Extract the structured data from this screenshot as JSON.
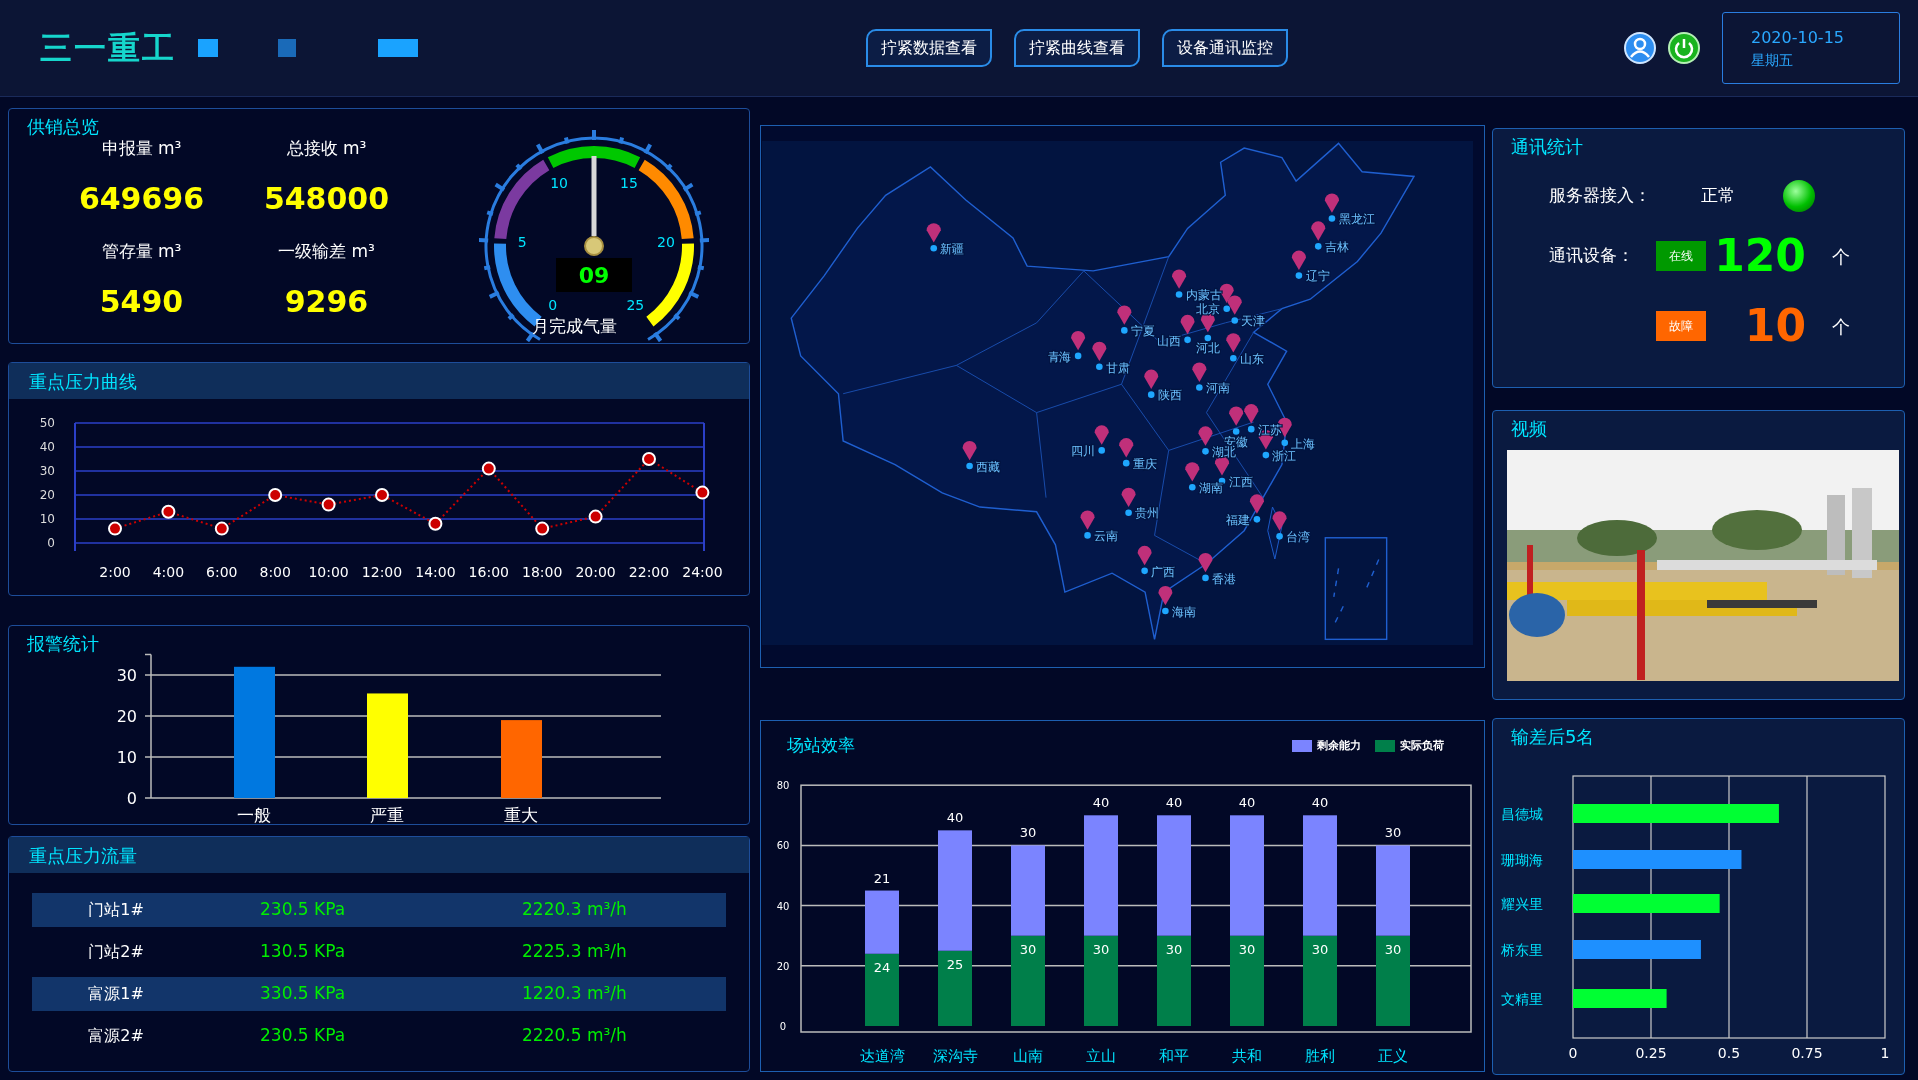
{
  "header": {
    "logo": "三一重工",
    "nav_buttons": [
      "拧紧数据查看",
      "拧紧曲线查看",
      "设备通讯监控"
    ],
    "date": "2020-10-15",
    "weekday": "星期五"
  },
  "supply_overview": {
    "title": "供销总览",
    "stats": [
      {
        "label": "申报量 m³",
        "value": "649696"
      },
      {
        "label": "总接收 m³",
        "value": "548000"
      },
      {
        "label": "管存量 m³",
        "value": "5490"
      },
      {
        "label": "一级输差 m³",
        "value": "9296"
      }
    ],
    "gauge": {
      "ticks": [
        "0",
        "5",
        "10",
        "15",
        "20",
        "25"
      ],
      "reading": "09",
      "label": "月完成气量"
    }
  },
  "pressure_curve": {
    "title": "重点压力曲线",
    "chart_data": {
      "type": "line",
      "categories": [
        "2:00",
        "4:00",
        "6:00",
        "8:00",
        "10:00",
        "12:00",
        "14:00",
        "16:00",
        "18:00",
        "20:00",
        "22:00",
        "24:00"
      ],
      "series": [
        {
          "color": "#cc0000",
          "line_style": "dotted",
          "marker": "circle",
          "values": [
            6,
            13,
            6,
            20,
            16,
            20,
            8,
            31,
            6,
            11,
            35,
            21
          ]
        }
      ],
      "ylim": [
        0,
        50
      ],
      "yticks": [
        0,
        10,
        20,
        30,
        40,
        50
      ],
      "grid": true
    }
  },
  "alarm_stats": {
    "title": "报警统计",
    "chart_data": {
      "type": "bar",
      "categories": [
        "一般",
        "严重",
        "重大"
      ],
      "series": [
        {
          "values": [
            32,
            25.5,
            19
          ]
        }
      ],
      "colors": [
        "#0078e0",
        "#ffff00",
        "#ff6600"
      ],
      "ylim": [
        0,
        35
      ],
      "yticks": [
        0,
        10,
        20,
        30
      ],
      "grid": true
    }
  },
  "pressure_flow": {
    "title": "重点压力流量",
    "rows": [
      {
        "station": "门站1#",
        "pressure": "230.5 KPa",
        "flow": "2220.3 m³/h"
      },
      {
        "station": "门站2#",
        "pressure": "130.5 KPa",
        "flow": "2225.3 m³/h"
      },
      {
        "station": "富源1#",
        "pressure": "330.5 KPa",
        "flow": "1220.3 m³/h"
      },
      {
        "station": "富源2#",
        "pressure": "230.5 KPa",
        "flow": "2220.5 m³/h"
      }
    ]
  },
  "map": {
    "markers": [
      "新疆",
      "黑龙江",
      "吉林",
      "辽宁",
      "内蒙古",
      "北京",
      "天津",
      "宁夏",
      "山西",
      "河北",
      "山东",
      "青海",
      "甘肃",
      "陕西",
      "河南",
      "安徽",
      "江苏",
      "上海",
      "四川",
      "湖北",
      "浙江",
      "西藏",
      "重庆",
      "江西",
      "湖南",
      "贵州",
      "福建",
      "台湾",
      "云南",
      "广西",
      "香港",
      "海南"
    ]
  },
  "station_efficiency": {
    "title": "场站效率",
    "chart_data": {
      "type": "bar",
      "stacked": true,
      "categories": [
        "达道湾",
        "深沟寺",
        "山南",
        "立山",
        "和平",
        "共和",
        "胜利",
        "正义"
      ],
      "series": [
        {
          "name": "剩余能力",
          "color": "#7b84ff",
          "values": [
            21,
            40,
            30,
            40,
            40,
            40,
            40,
            30
          ]
        },
        {
          "name": "实际负荷",
          "color": "#007f4a",
          "values": [
            24,
            25,
            30,
            30,
            30,
            30,
            30,
            30
          ]
        }
      ],
      "ylim": [
        0,
        80
      ],
      "yticks": [
        0,
        20,
        40,
        60,
        80
      ],
      "data_labels": true,
      "grid": true
    }
  },
  "comms": {
    "title": "通讯统计",
    "server_label": "服务器接入：",
    "server_status": "正常",
    "server_online": true,
    "device_label": "通讯设备：",
    "devices": [
      {
        "kind": "online",
        "badge": "在线",
        "count": "120",
        "unit": "个"
      },
      {
        "kind": "fault",
        "badge": "故障",
        "count": "10",
        "unit": "个"
      }
    ]
  },
  "video": {
    "title": "视频",
    "kind": "picture"
  },
  "ranking": {
    "title": "输差后5名",
    "chart_data": {
      "type": "bar",
      "orientation": "horizontal",
      "categories": [
        "昌德城",
        "珊瑚海",
        "耀兴里",
        "桥东里",
        "文精里"
      ],
      "series": [
        {
          "values": [
            0.66,
            0.54,
            0.47,
            0.41,
            0.3
          ]
        }
      ],
      "colors": [
        "#00ff33",
        "#1e90ff",
        "#00ff33",
        "#1e90ff",
        "#00ff33"
      ],
      "xlim": [
        0,
        1
      ],
      "xticks": [
        0,
        0.25,
        0.5,
        0.75,
        1
      ],
      "grid": true
    }
  }
}
